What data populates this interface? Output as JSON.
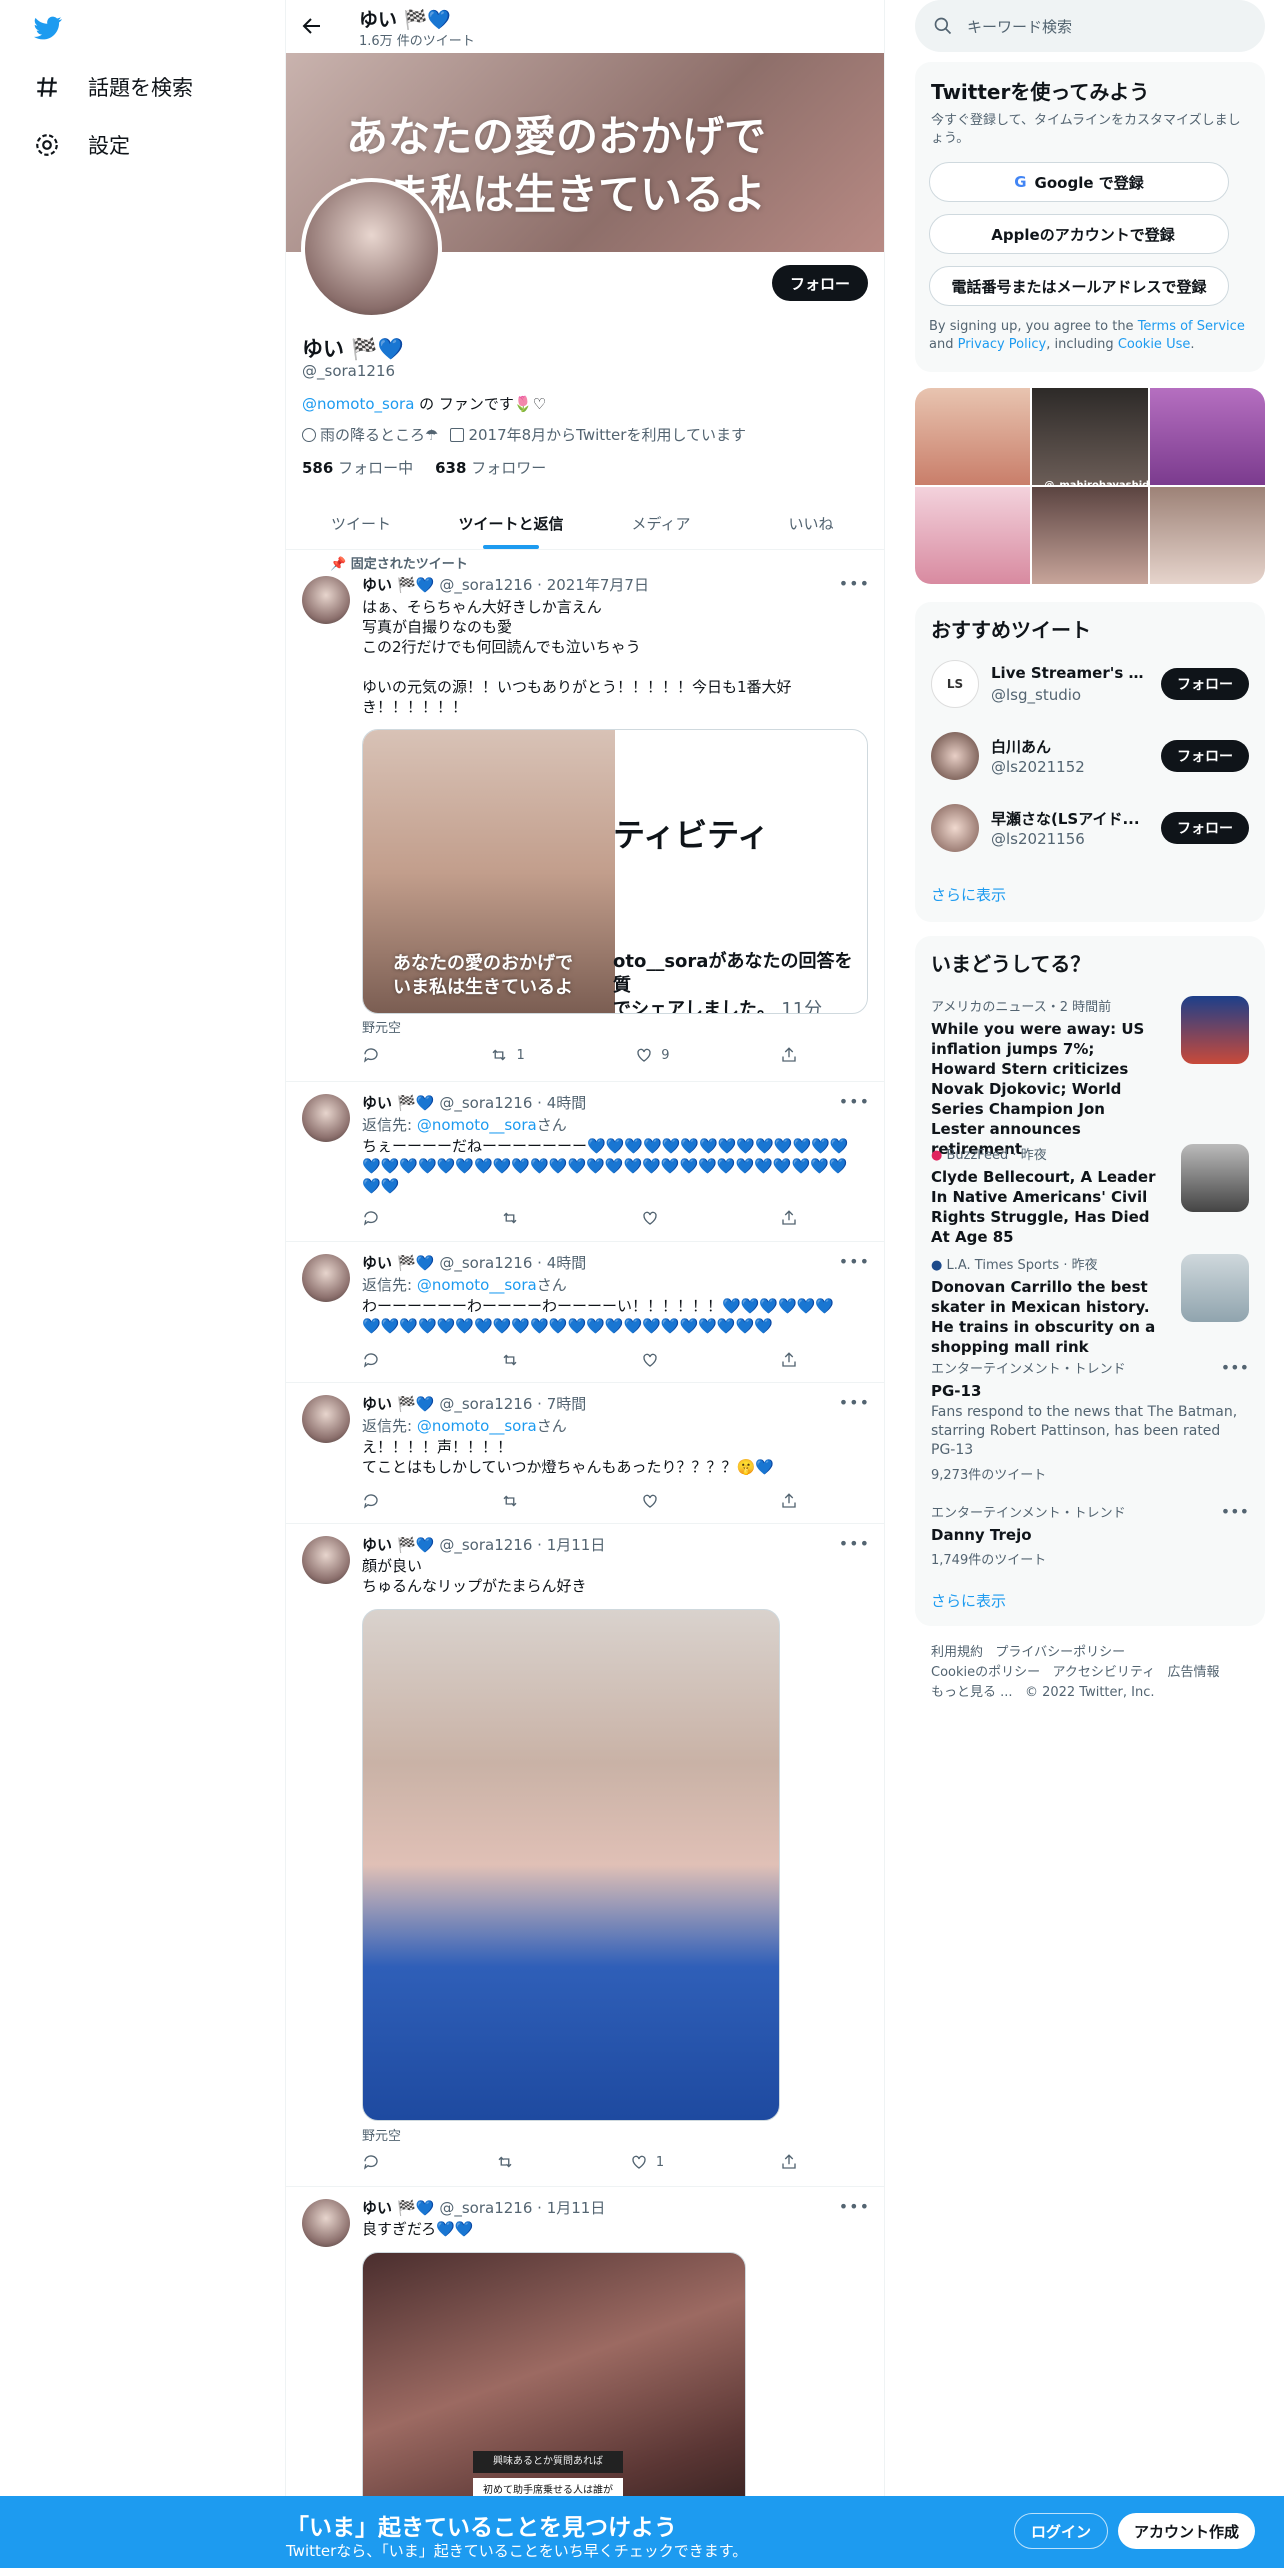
{
  "nav": {
    "explore_label": "話題を検索",
    "settings_label": "設定"
  },
  "header": {
    "title": "ゆい 🏁💙",
    "subtitle": "1.6万 件のツイート"
  },
  "banner": {
    "text": "あなたの愛のおかげで\nいま私は生きているよ"
  },
  "profile": {
    "follow_label": "フォロー",
    "name": "ゆい 🏁💙",
    "handle": "@_sora1216",
    "bio_link": "@nomoto_sora",
    "bio_rest": " の ファンです🌷♡",
    "location": "雨の降るところ☂",
    "joined": "2017年8月からTwitterを利用しています",
    "following_count": "586",
    "following_label": "フォロー中",
    "followers_count": "638",
    "followers_label": "フォロワー"
  },
  "tabs": [
    "ツイート",
    "ツイートと返信",
    "メディア",
    "いいね"
  ],
  "pinned_label": "固定されたツイート",
  "tweets": [
    {
      "name": "ゆい 🏁💙",
      "handle": "@_sora1216",
      "time": "2021年7月7日",
      "body": "はぁ、そらちゃん大好きしか言えん\n写真が自撮りなのも愛\nこの2行だけでも何回読んでも泣いちゃう\n\nゆいの元気の源！！いつもありがとう！！！！！今日も1番大好き！！！！！！",
      "card_title": "ティビティ",
      "card_caption": "あなたの愛のおかげで\nいま私は生きているよ",
      "card_text": "oto__soraがあなたの回答を質\nでシェアしました。",
      "card_time": "11分",
      "source": "野元空",
      "retweets": "1",
      "likes": "9"
    },
    {
      "name": "ゆい 🏁💙",
      "handle": "@_sora1216",
      "time": "4時間",
      "reply_to_label": "返信先: ",
      "reply_to": "@nomoto__sora",
      "reply_suffix": "さん",
      "body": "ちぇーーーーだねーーーーーーー💙💙💙💙💙💙💙💙💙💙💙💙💙💙💙💙💙💙💙💙💙💙💙💙💙💙💙💙💙💙💙💙💙💙💙💙💙💙💙💙💙💙"
    },
    {
      "name": "ゆい 🏁💙",
      "handle": "@_sora1216",
      "time": "4時間",
      "reply_to_label": "返信先: ",
      "reply_to": "@nomoto__sora",
      "reply_suffix": "さん",
      "body": "わーーーーーーわーーーーわーーーーい！！！！！！💙💙💙💙💙💙💙💙💙💙💙💙💙💙💙💙💙💙💙💙💙💙💙💙💙💙💙💙"
    },
    {
      "name": "ゆい 🏁💙",
      "handle": "@_sora1216",
      "time": "7時間",
      "reply_to_label": "返信先: ",
      "reply_to": "@nomoto__sora",
      "reply_suffix": "さん",
      "body": "え！！！！声！！！！\nてことはもしかしていつか燈ちゃんもあったり？？？？🤫💙"
    },
    {
      "name": "ゆい 🏁💙",
      "handle": "@_sora1216",
      "time": "1月11日",
      "body": "顔が良い\nちゅるんなリップがたまらん好き",
      "source": "野元空",
      "likes": "1"
    },
    {
      "name": "ゆい 🏁💙",
      "handle": "@_sora1216",
      "time": "1月11日",
      "body": "良すぎだろ💙💙",
      "media_text": "興味あるとか質問あれば",
      "media_text2": "初めて助手席乗せる人は誰が"
    }
  ],
  "right": {
    "search_placeholder": "キーワード検索",
    "signup": {
      "title": "Twitterを使ってみよう",
      "desc": "今すぐ登録して、タイムラインをカスタマイズしましょう。",
      "google": "Google で登録",
      "apple": "Appleのアカウントで登録",
      "phone": "電話番号またはメールアドレスで登録",
      "terms_pre": "By signing up, you agree to the ",
      "terms_tos": "Terms of Service",
      "terms_and": " and ",
      "terms_privacy": "Privacy Policy",
      "terms_incl": ", including ",
      "terms_cookie": "Cookie Use",
      "terms_end": "."
    },
    "grid_label": "@_mahirohayashida",
    "recommended": {
      "title": "おすすめツイート",
      "accounts": [
        {
          "name": "Live Streamer's Guil...",
          "handle": "@lsg_studio",
          "button": "フォロー"
        },
        {
          "name": "白川あん",
          "handle": "@ls2021152",
          "button": "フォロー"
        },
        {
          "name": "早瀬さな(LSアイド...",
          "handle": "@ls2021156",
          "button": "フォロー"
        }
      ],
      "more": "さらに表示"
    },
    "trends": {
      "title": "いまどうしてる？",
      "items": [
        {
          "category": "アメリカのニュース・2 時間前",
          "headline": "While you were away: US inflation jumps 7%; Howard Stern criticizes Novak Djokovic; World Series Champion Jon Lester announces retirement"
        },
        {
          "category": "BuzzFeed · 昨夜",
          "headline": "Clyde Bellecourt, A Leader In Native Americans' Civil Rights Struggle, Has Died At Age 85"
        },
        {
          "category": "L.A. Times Sports · 昨夜",
          "headline": "Donovan Carrillo the best skater in Mexican history. He trains in obscurity on a shopping mall rink"
        },
        {
          "category": "エンターテインメント・トレンド",
          "headline": "PG-13",
          "desc": "Fans respond to the news that The Batman, starring Robert Pattinson, has been rated PG-13",
          "count": "9,273件のツイート"
        },
        {
          "category": "エンターテインメント・トレンド",
          "headline": "Danny Trejo",
          "count": "1,749件のツイート"
        }
      ],
      "more": "さらに表示"
    },
    "footer": {
      "l1": "利用規約",
      "l2": "プライバシーポリシー",
      "l3": "Cookieのポリシー",
      "l4": "アクセシビリティ",
      "l5": "広告情報",
      "l6": "もっと見る ...",
      "copy": "© 2022 Twitter, Inc."
    }
  },
  "bottom": {
    "title": "「いま」起きていることを見つけよう",
    "subtitle": "Twitterなら、「いま」起きていることをいち早くチェックできます。",
    "login": "ログイン",
    "signup": "アカウント作成"
  },
  "colors": {
    "accent": "#1d9bf0",
    "text": "#0f1419",
    "secondary": "#536471"
  }
}
